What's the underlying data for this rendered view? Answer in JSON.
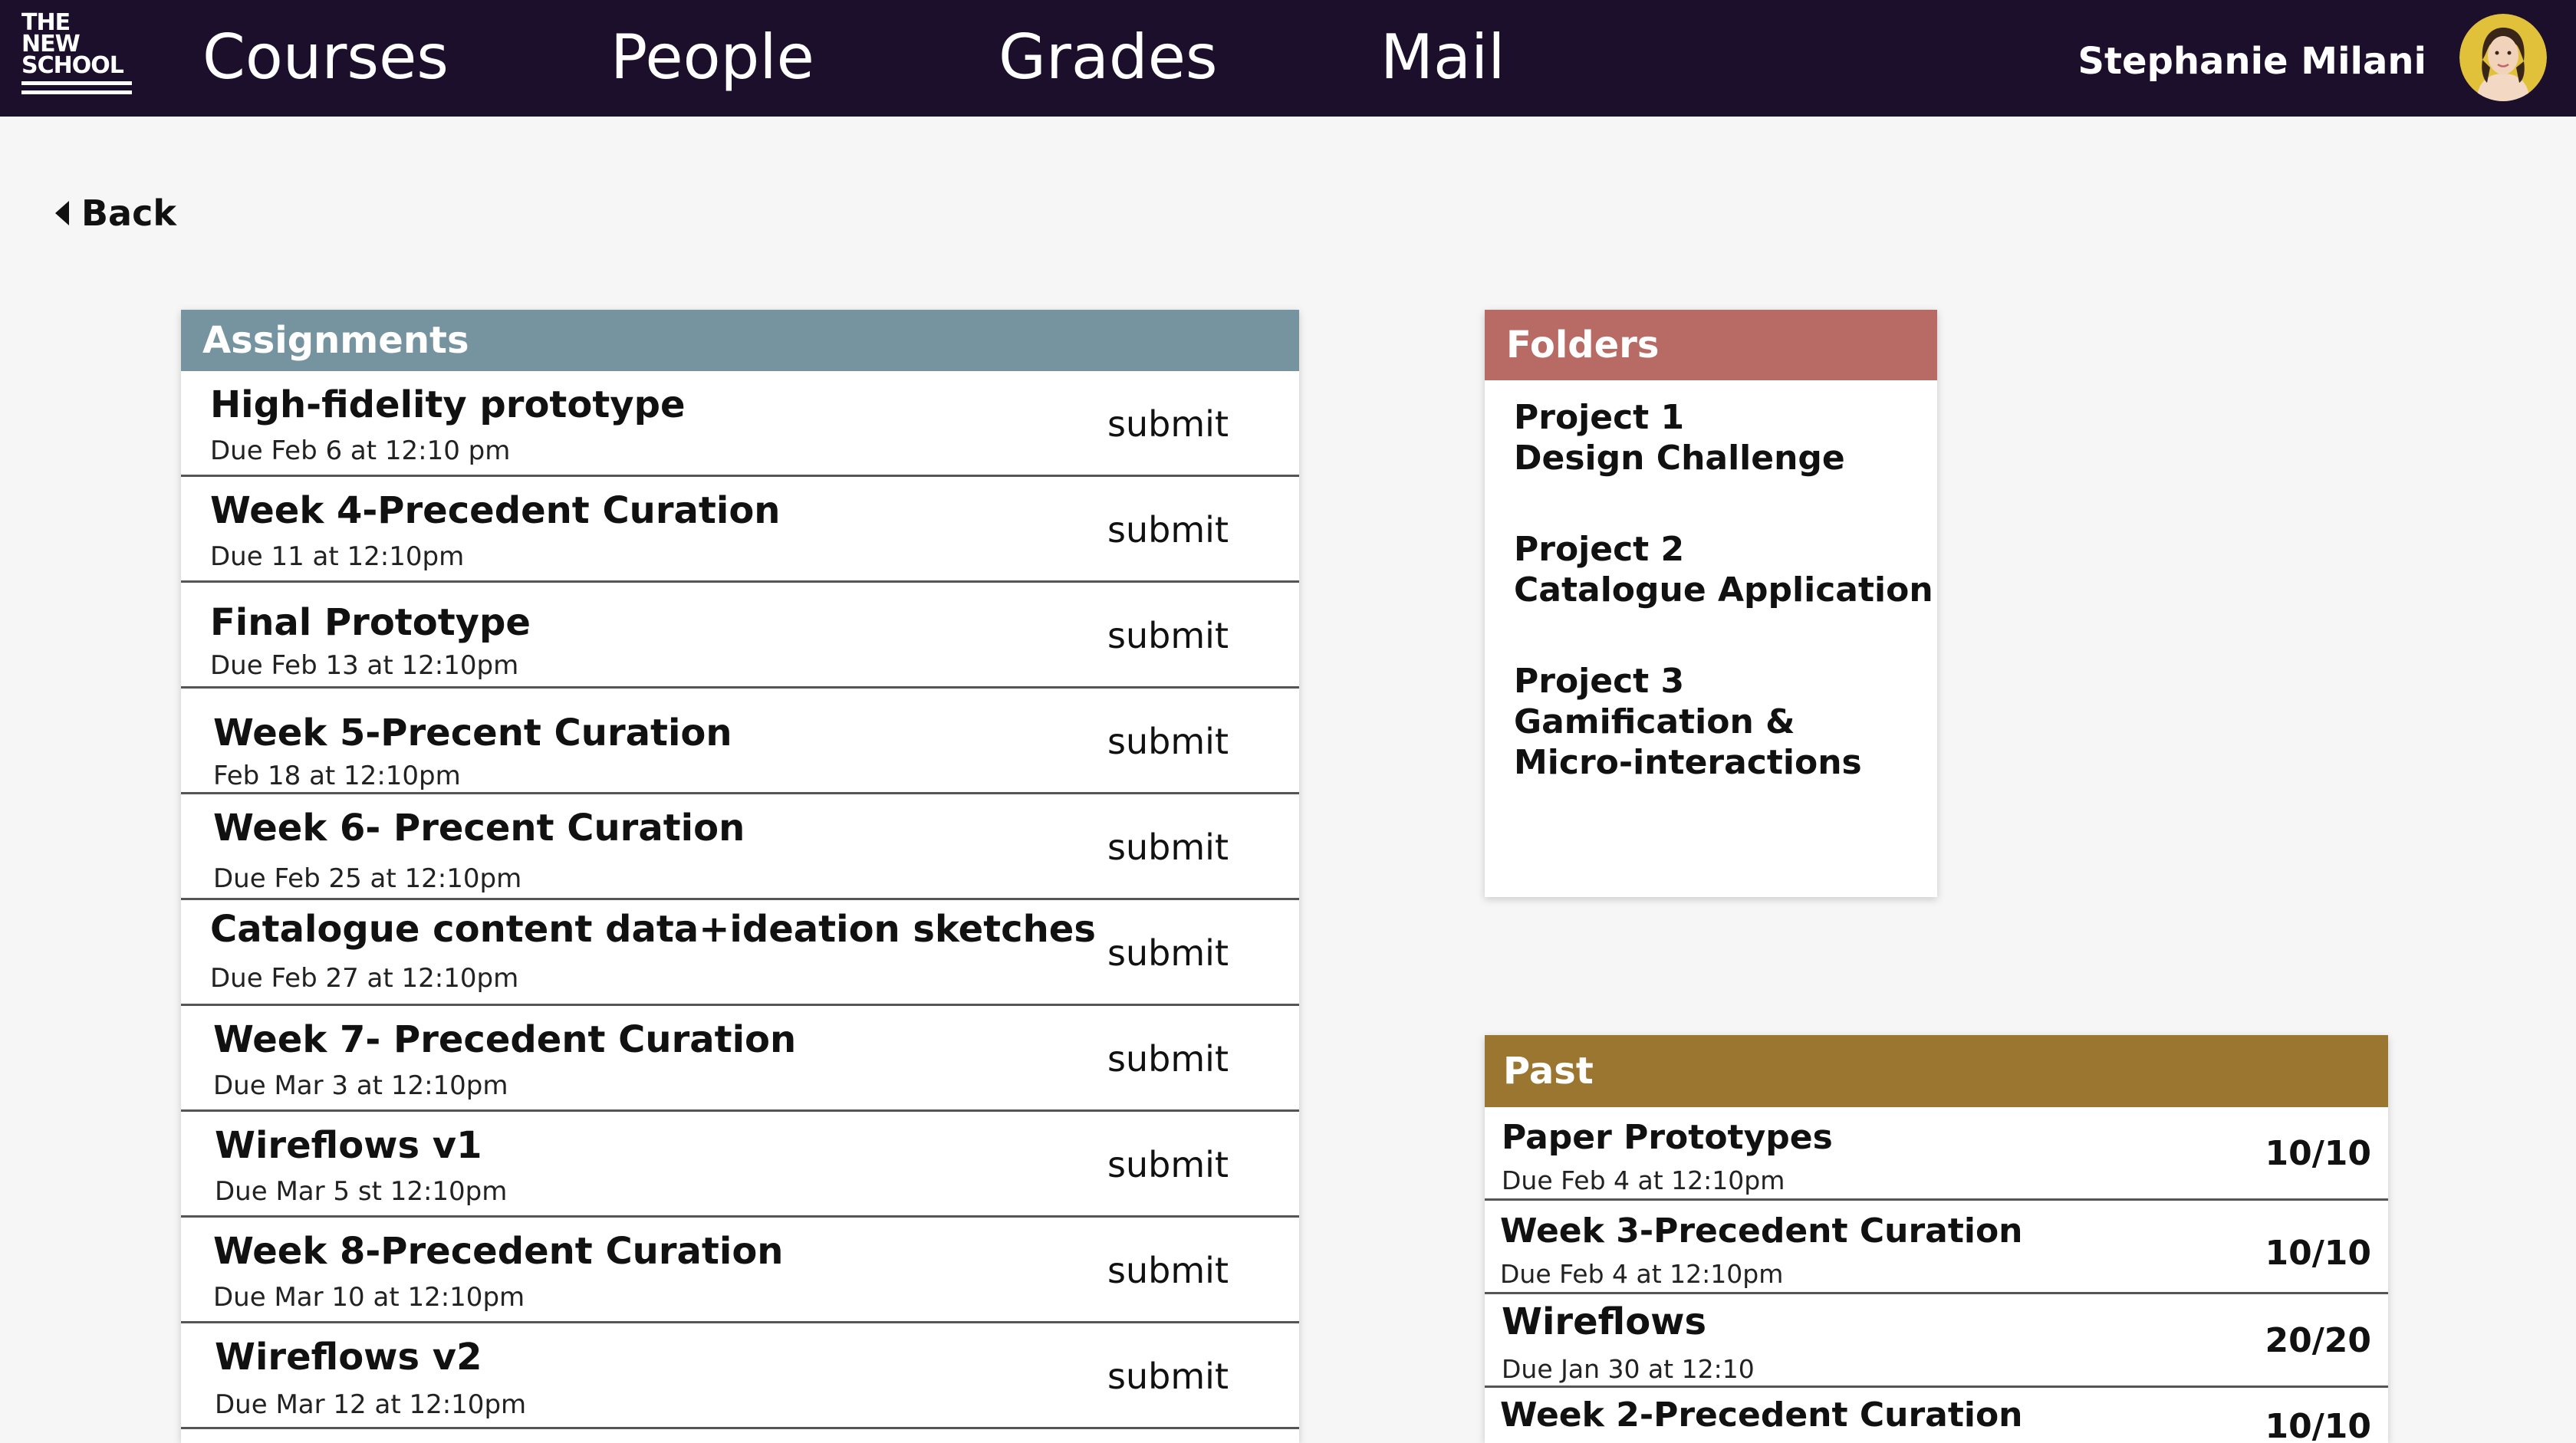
{
  "brand": {
    "logo_lines": [
      "THE",
      "NEW",
      "SCHOOL"
    ]
  },
  "nav": {
    "items": [
      {
        "label": "Courses"
      },
      {
        "label": "People"
      },
      {
        "label": "Grades"
      },
      {
        "label": "Mail"
      }
    ],
    "user_name": "Stephanie Milani",
    "colors": {
      "bar": "#1c0f2b"
    }
  },
  "back": {
    "label": "Back",
    "icon": "caret-left-icon"
  },
  "assignments": {
    "title": "Assignments",
    "color": "#7694a0",
    "items": [
      {
        "title": "High-fidelity prototype",
        "due": "Due Feb 6 at 12:10 pm",
        "action": "submit"
      },
      {
        "title": "Week 4-Precedent Curation",
        "due": "Due 11 at 12:10pm",
        "action": "submit"
      },
      {
        "title": "Final Prototype",
        "due": "Due Feb 13 at 12:10pm",
        "action": "submit"
      },
      {
        "title": "Week 5-Precent Curation",
        "due": "Feb 18 at 12:10pm",
        "action": "submit"
      },
      {
        "title": "Week 6- Precent Curation",
        "due": "Due Feb 25 at 12:10pm",
        "action": "submit"
      },
      {
        "title": "Catalogue content data+ideation sketches",
        "due": "Due Feb 27 at 12:10pm",
        "action": "submit"
      },
      {
        "title": "Week 7- Precedent Curation",
        "due": "Due Mar 3 at 12:10pm",
        "action": "submit"
      },
      {
        "title": "Wireflows v1",
        "due": "Due Mar 5 st 12:10pm",
        "action": "submit"
      },
      {
        "title": "Week 8-Precedent Curation",
        "due": "Due Mar 10 at 12:10pm",
        "action": "submit"
      },
      {
        "title": "Wireflows v2",
        "due": "Due Mar 12 at 12:10pm",
        "action": "submit"
      }
    ]
  },
  "folders": {
    "title": "Folders",
    "color": "#b86a64",
    "items": [
      {
        "line1": "Project 1",
        "line2": "Design Challenge",
        "line3": ""
      },
      {
        "line1": "Project 2",
        "line2": "Catalogue Application",
        "line3": ""
      },
      {
        "line1": "Project 3",
        "line2": "Gamification &",
        "line3": "Micro-interactions"
      }
    ]
  },
  "past": {
    "title": "Past",
    "color": "#9a7630",
    "items": [
      {
        "title": "Paper Prototypes",
        "due": "Due Feb 4 at 12:10pm",
        "score": "10/10"
      },
      {
        "title": "Week 3-Precedent Curation",
        "due": "Due Feb 4 at 12:10pm",
        "score": "10/10"
      },
      {
        "title": "Wireflows",
        "due": "Due Jan 30 at 12:10",
        "score": "20/20"
      },
      {
        "title": "Week 2-Precedent Curation",
        "due": "",
        "score": "10/10"
      }
    ]
  }
}
